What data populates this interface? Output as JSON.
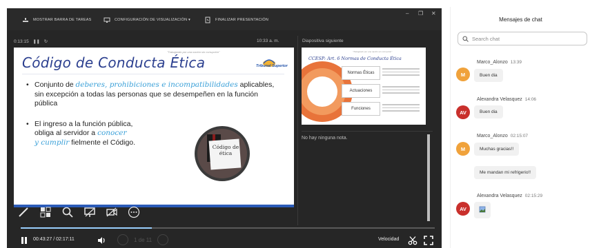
{
  "colors": {
    "presenter_bg": "#262626",
    "slide_title": "#2b3f8f",
    "accent_text": "#3aa0d8",
    "progress": "#9ad0ff",
    "avatar_orange": "#f0a23b",
    "avatar_red": "#c9302c"
  },
  "toolbar": {
    "show_taskbar": "MOSTRAR BARRA DE TAREAS",
    "display_settings": "CONFIGURACIÓN DE VISUALIZACIÓN ▾",
    "end_presentation": "FINALIZAR PRESENTACIÓN",
    "minimize": "–",
    "restore": "❐",
    "close": "✕"
  },
  "presenter": {
    "elapsed": "0:13:15",
    "clock": "10:33 a. m.",
    "next_slide_label": "Diapositiva siguiente",
    "notes_text": "No hay ninguna nota."
  },
  "slide": {
    "title": "Código de Conducta Ética",
    "tagline": "\"Trabajando por una nación sin corrupción\"",
    "logo_text": "Tribunal Superior",
    "bullet1_pre": "Conjunto de ",
    "bullet1_accent": "deberes, prohibiciones e incompatibilidades",
    "bullet1_post": " aplicables, sin excepción a todas las personas que se desempeñen en la función pública",
    "bullet2_line1": "El ingreso a la función pública,",
    "bullet2_line2_pre": "obliga al servidor a ",
    "bullet2_line2_accent": "conocer",
    "bullet2_line3_accent": "y cumplir",
    "bullet2_line3_post": " fielmente el Código.",
    "image_text": "Código de ética"
  },
  "next_slide": {
    "title": "CCESP: Art. 6 Normas de Conducta Ética",
    "subtitle": "\"Trabajando por una nación sin corrupción\"",
    "items": [
      "Normas Éticas",
      "Actuaciones",
      "Funciones"
    ]
  },
  "tools": [
    "pen-icon",
    "slides-grid-icon",
    "zoom-icon",
    "screen-icon",
    "camera-off-icon",
    "more-icon"
  ],
  "player": {
    "time": "00:43:27 / 02:17:11",
    "speed_label": "Velocidad",
    "progress": 0.316,
    "ghost_nav": "1 de 11"
  },
  "chat": {
    "title": "Mensajes de chat",
    "search_placeholder": "Search chat",
    "messages": [
      {
        "initials": "M",
        "sender": "Marco_Alonzo",
        "time": "13:39",
        "text": "Buen dia",
        "color": "#f0a23b"
      },
      {
        "initials": "AV",
        "sender": "Alexandra Velasquez",
        "time": "14:06",
        "text": "Buen dia",
        "color": "#c9302c"
      },
      {
        "initials": "M",
        "sender": "Marco_Alonzo",
        "time": "02:15:07",
        "text": "Muchas gracias!!",
        "color": "#f0a23b"
      },
      {
        "initials": "",
        "sender": "",
        "time": "",
        "text": "Me mandan mi refrigerio!!",
        "color": ""
      },
      {
        "initials": "AV",
        "sender": "Alexandra Velasquez",
        "time": "02:15:29",
        "text": "",
        "color": "#c9302c"
      }
    ]
  }
}
